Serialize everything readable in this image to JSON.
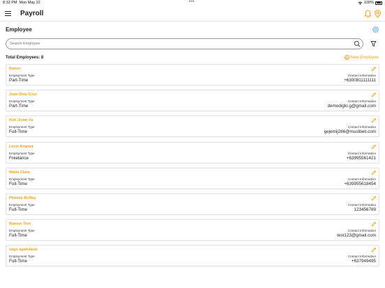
{
  "status_bar": {
    "time": "8:33 PM",
    "date": "Mon May 22",
    "battery": "100%"
  },
  "app_bar": {
    "title": "Payroll"
  },
  "section": {
    "title": "Employee"
  },
  "search": {
    "placeholder": "Search Employee",
    "value": ""
  },
  "summary": {
    "total_label": "Total Employees: 8",
    "new_button": "New Employee"
  },
  "labels": {
    "employment_type": "Employment Type",
    "contact_information": "Contact Information"
  },
  "colors": {
    "accent": "#f4a21c",
    "card_border": "#e2e2e2"
  },
  "employees": [
    {
      "name": "Danzo",
      "employment_type": "Part-Time",
      "contact": "+6300811111111"
    },
    {
      "name": "Juan Dela Cruz",
      "employment_type": "Part-Time",
      "contact": "demodiglo.g@gmail.com"
    },
    {
      "name": "Kim Jisoo Ya",
      "employment_type": "Full-Time",
      "contact": "gejemij286@mustbeit.com"
    },
    {
      "name": "Lexie Kramer",
      "employment_type": "Freelance",
      "contact": "+63995561421"
    },
    {
      "name": "Maria Clara",
      "employment_type": "Full-Time",
      "contact": "+639955618454"
    },
    {
      "name": "Phoebe Buffay",
      "employment_type": "Full-Time",
      "contact": "123456789"
    },
    {
      "name": "Ramon Test",
      "employment_type": "Full-Time",
      "contact": "test123@gmail.com"
    },
    {
      "name": "vago agahdarat",
      "employment_type": "Full-Time",
      "contact": "+637949495"
    }
  ]
}
